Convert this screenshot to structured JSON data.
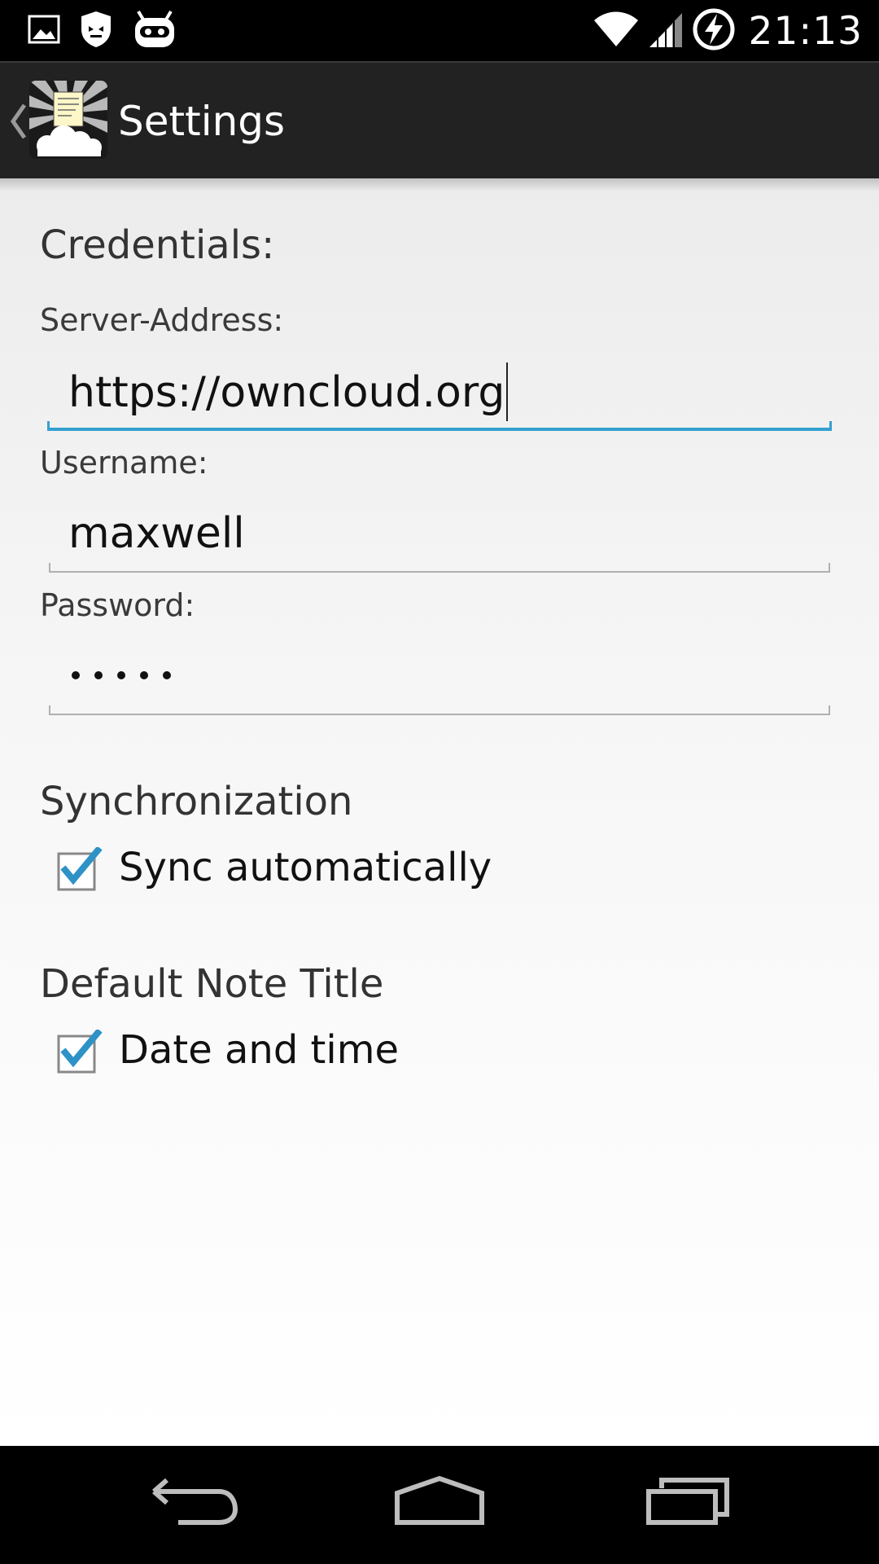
{
  "status_bar": {
    "left_icons": [
      "image-icon",
      "guardian-shield-icon",
      "cyanogen-mascot-icon"
    ],
    "right_icons": [
      "wifi-icon",
      "cell-signal-icon",
      "battery-charging-icon"
    ],
    "time": "21:13"
  },
  "action_bar": {
    "title": "Settings",
    "app_icon": "owncloud-notes-app-icon"
  },
  "credentials": {
    "heading": "Credentials:",
    "server_label": "Server-Address:",
    "server_value": "https://owncloud.org",
    "username_label": "Username:",
    "username_value": "maxwell",
    "password_label": "Password:",
    "password_length": 5
  },
  "synchronization": {
    "heading": "Synchronization",
    "sync_auto_label": "Sync automatically",
    "sync_auto_checked": true
  },
  "default_note_title": {
    "heading": "Default Note Title",
    "date_time_label": "Date and time",
    "date_time_checked": true
  },
  "nav_bar": {
    "buttons": [
      "back-icon",
      "home-icon",
      "recents-icon"
    ]
  },
  "colors": {
    "accent": "#33a0cf",
    "action_bar_bg": "#222222",
    "content_bg": "#f4f4f4"
  }
}
